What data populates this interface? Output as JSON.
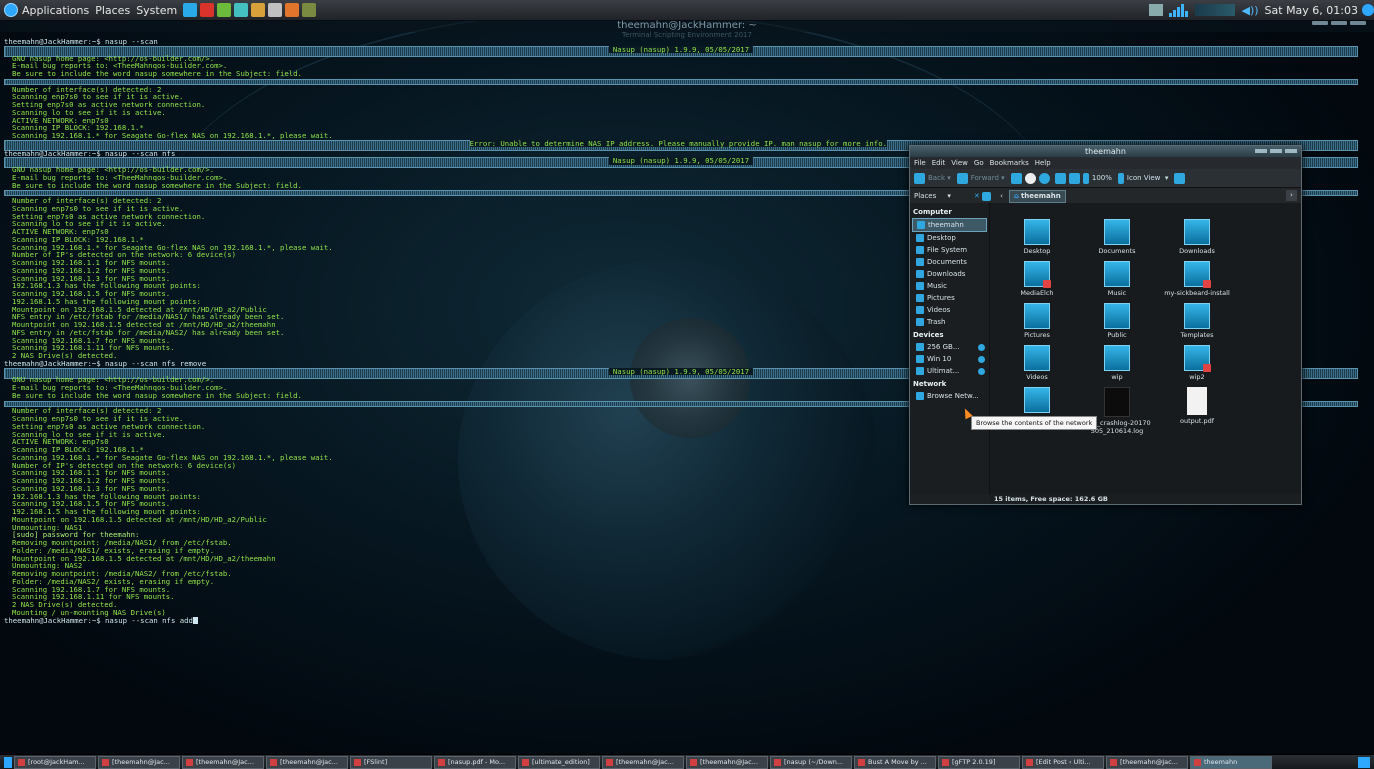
{
  "top_panel": {
    "menus": [
      "Applications",
      "Places",
      "System"
    ],
    "clock": "Sat May  6, 01:03"
  },
  "terminal": {
    "title": "theemahn@JackHammer: ~",
    "subtitle": "Terminal Scripting Environment 2017",
    "banner": "Nasup (nasup) 1.9.9, 05/05/2017",
    "lines": [
      {
        "t": "prompt",
        "s": "theemahn@JackHammer:~$ nasup --scan"
      },
      {
        "t": "out",
        "s": "GNU nasup home page: <http://os-builder.com/>."
      },
      {
        "t": "out",
        "s": "E-mail bug reports to: <TheeMahnqos-builder.com>."
      },
      {
        "t": "out",
        "s": "Be sure to include the word nasup somewhere in the Subject: field."
      },
      {
        "t": "out",
        "s": "Number of interface(s) detected: 2"
      },
      {
        "t": "out",
        "s": "Scanning enp7s0 to see if it is active."
      },
      {
        "t": "out",
        "s": "Setting enp7s0 as active network connection."
      },
      {
        "t": "out",
        "s": "Scanning lo to see if it is active."
      },
      {
        "t": "out",
        "s": "ACTIVE NETWORK: enp7s0"
      },
      {
        "t": "out",
        "s": "Scanning IP BLOCK: 192.168.1.*"
      },
      {
        "t": "out",
        "s": "Scanning 192.168.1.* for Seagate Go-flex NAS on 192.168.1.*, please wait."
      },
      {
        "t": "err",
        "s": "Error: Unable to determine NAS IP address. Please manually provide IP. man nasup for more info."
      },
      {
        "t": "prompt",
        "s": "theemahn@JackHammer:~$ nasup --scan nfs"
      },
      {
        "t": "out",
        "s": "GNU nasup home page: <http://os-builder.com/>."
      },
      {
        "t": "out",
        "s": "E-mail bug reports to: <TheeMahnqos-builder.com>."
      },
      {
        "t": "out",
        "s": "Be sure to include the word nasup somewhere in the Subject: field."
      },
      {
        "t": "out",
        "s": "Number of interface(s) detected: 2"
      },
      {
        "t": "out",
        "s": "Scanning enp7s0 to see if it is active."
      },
      {
        "t": "out",
        "s": "Setting enp7s0 as active network connection."
      },
      {
        "t": "out",
        "s": "Scanning lo to see if it is active."
      },
      {
        "t": "out",
        "s": "ACTIVE NETWORK: enp7s0"
      },
      {
        "t": "out",
        "s": "Scanning IP BLOCK: 192.168.1.*"
      },
      {
        "t": "out",
        "s": "Scanning 192.168.1.* for Seagate Go-flex NAS on 192.168.1.*, please wait."
      },
      {
        "t": "out",
        "s": "Number of IP's detected on the network: 6 device(s)"
      },
      {
        "t": "out",
        "s": "Scanning 192.168.1.1 for NFS mounts."
      },
      {
        "t": "out",
        "s": "Scanning 192.168.1.2 for NFS mounts."
      },
      {
        "t": "out",
        "s": "Scanning 192.168.1.3 for NFS mounts."
      },
      {
        "t": "out",
        "s": "192.168.1.3 has the following mount points:"
      },
      {
        "t": "out",
        "s": "Scanning 192.168.1.5 for NFS mounts."
      },
      {
        "t": "out",
        "s": "192.168.1.5 has the following mount points:"
      },
      {
        "t": "out",
        "s": "Mountpoint on 192.168.1.5 detected at /mnt/HD/HD_a2/Public"
      },
      {
        "t": "out",
        "s": "NFS entry in /etc/fstab for /media/NAS1/ has already been set."
      },
      {
        "t": "out",
        "s": "Mountpoint on 192.168.1.5 detected at /mnt/HD/HD_a2/theemahn"
      },
      {
        "t": "out",
        "s": "NFS entry in /etc/fstab for /media/NAS2/ has already been set."
      },
      {
        "t": "out",
        "s": "Scanning 192.168.1.7 for NFS mounts."
      },
      {
        "t": "out",
        "s": "Scanning 192.168.1.11 for NFS mounts."
      },
      {
        "t": "out",
        "s": "2 NAS Drive(s) detected."
      },
      {
        "t": "prompt",
        "s": "theemahn@JackHammer:~$ nasup --scan nfs remove"
      },
      {
        "t": "out",
        "s": "GNU nasup home page: <http://os-builder.com/>."
      },
      {
        "t": "out",
        "s": "E-mail bug reports to: <TheeMahnqos-builder.com>."
      },
      {
        "t": "out",
        "s": "Be sure to include the word nasup somewhere in the Subject: field."
      },
      {
        "t": "out",
        "s": "Number of interface(s) detected: 2"
      },
      {
        "t": "out",
        "s": "Scanning enp7s0 to see if it is active."
      },
      {
        "t": "out",
        "s": "Setting enp7s0 as active network connection."
      },
      {
        "t": "out",
        "s": "Scanning lo to see if it is active."
      },
      {
        "t": "out",
        "s": "ACTIVE NETWORK: enp7s0"
      },
      {
        "t": "out",
        "s": "Scanning IP BLOCK: 192.168.1.*"
      },
      {
        "t": "out",
        "s": "Scanning 192.168.1.* for Seagate Go-flex NAS on 192.168.1.*, please wait."
      },
      {
        "t": "out",
        "s": "Number of IP's detected on the network: 6 device(s)"
      },
      {
        "t": "out",
        "s": "Scanning 192.168.1.1 for NFS mounts."
      },
      {
        "t": "out",
        "s": "Scanning 192.168.1.2 for NFS mounts."
      },
      {
        "t": "out",
        "s": "Scanning 192.168.1.3 for NFS mounts."
      },
      {
        "t": "out",
        "s": "192.168.1.3 has the following mount points:"
      },
      {
        "t": "out",
        "s": "Scanning 192.168.1.5 for NFS mounts."
      },
      {
        "t": "out",
        "s": "192.168.1.5 has the following mount points:"
      },
      {
        "t": "out",
        "s": "Mountpoint on 192.168.1.5 detected at /mnt/HD/HD_a2/Public"
      },
      {
        "t": "out",
        "s": "Unmounting: NAS1"
      },
      {
        "t": "out2",
        "s": "[sudo] password for theemahn:"
      },
      {
        "t": "out",
        "s": "Removing mountpoint: /media/NAS1/ from /etc/fstab."
      },
      {
        "t": "out",
        "s": "Folder: /media/NAS1/ exists, erasing if empty."
      },
      {
        "t": "out",
        "s": "Mountpoint on 192.168.1.5 detected at /mnt/HD/HD_a2/theemahn"
      },
      {
        "t": "out",
        "s": "Unmounting: NAS2"
      },
      {
        "t": "out",
        "s": "Removing mountpoint: /media/NAS2/ from /etc/fstab."
      },
      {
        "t": "out",
        "s": "Folder: /media/NAS2/ exists, erasing if empty."
      },
      {
        "t": "out",
        "s": "Scanning 192.168.1.7 for NFS mounts."
      },
      {
        "t": "out",
        "s": "Scanning 192.168.1.11 for NFS mounts."
      },
      {
        "t": "out",
        "s": "2 NAS Drive(s) detected."
      },
      {
        "t": "out",
        "s": "Mounting / un-mounting NAS Drive(s)"
      },
      {
        "t": "prompt",
        "s": "theemahn@JackHammer:~$ nasup --scan nfs add"
      }
    ]
  },
  "file_manager": {
    "title": "theemahn",
    "menu": [
      "File",
      "Edit",
      "View",
      "Go",
      "Bookmarks",
      "Help"
    ],
    "toolbar": {
      "back": "Back",
      "forward": "Forward",
      "zoom": "100%",
      "view": "Icon View"
    },
    "places_label": "Places",
    "path_button": "theemahn",
    "sidebar": {
      "computer_label": "Computer",
      "computer": [
        "theemahn",
        "Desktop",
        "File System",
        "Documents",
        "Downloads",
        "Music",
        "Pictures",
        "Videos",
        "Trash"
      ],
      "devices_label": "Devices",
      "devices": [
        "256 GB...",
        "Win 10",
        "Ultimat..."
      ],
      "network_label": "Network",
      "network": [
        "Browse Netw..."
      ]
    },
    "items": [
      {
        "label": "Desktop",
        "kind": "folder"
      },
      {
        "label": "Documents",
        "kind": "folder"
      },
      {
        "label": "Downloads",
        "kind": "folder"
      },
      {
        "label": "MediaElch",
        "kind": "folder-locked"
      },
      {
        "label": "Music",
        "kind": "folder"
      },
      {
        "label": "my-sickbeard-install",
        "kind": "folder-locked"
      },
      {
        "label": "Pictures",
        "kind": "folder"
      },
      {
        "label": "Public",
        "kind": "folder"
      },
      {
        "label": "Templates",
        "kind": "folder"
      },
      {
        "label": "Videos",
        "kind": "folder"
      },
      {
        "label": "wip",
        "kind": "folder"
      },
      {
        "label": "wip2",
        "kind": "folder-locked"
      },
      {
        "label": "",
        "kind": "folder"
      },
      {
        "label": "kodi_crashlog-20170505_210614.log",
        "kind": "file-dark"
      },
      {
        "label": "output.pdf",
        "kind": "file-pdf"
      }
    ],
    "status": "15 items, Free space: 162.6 GB",
    "tooltip": "Browse the contents of the network"
  },
  "taskbar": {
    "tasks": [
      "[root@JackHam...",
      "[theemahn@Jac...",
      "[theemahn@Jac...",
      "[theemahn@Jac...",
      "[FSlint]",
      "[nasup.pdf - Mo...",
      "[ultimate_edition]",
      "[theemahn@Jac...",
      "[theemahn@Jac...",
      "[nasup (~/Down...",
      "Bust A Move by ...",
      "[gFTP 2.0.19]",
      "[Edit Post ‹ Ulti...",
      "[theemahn@Jac...",
      "theemahn"
    ]
  }
}
